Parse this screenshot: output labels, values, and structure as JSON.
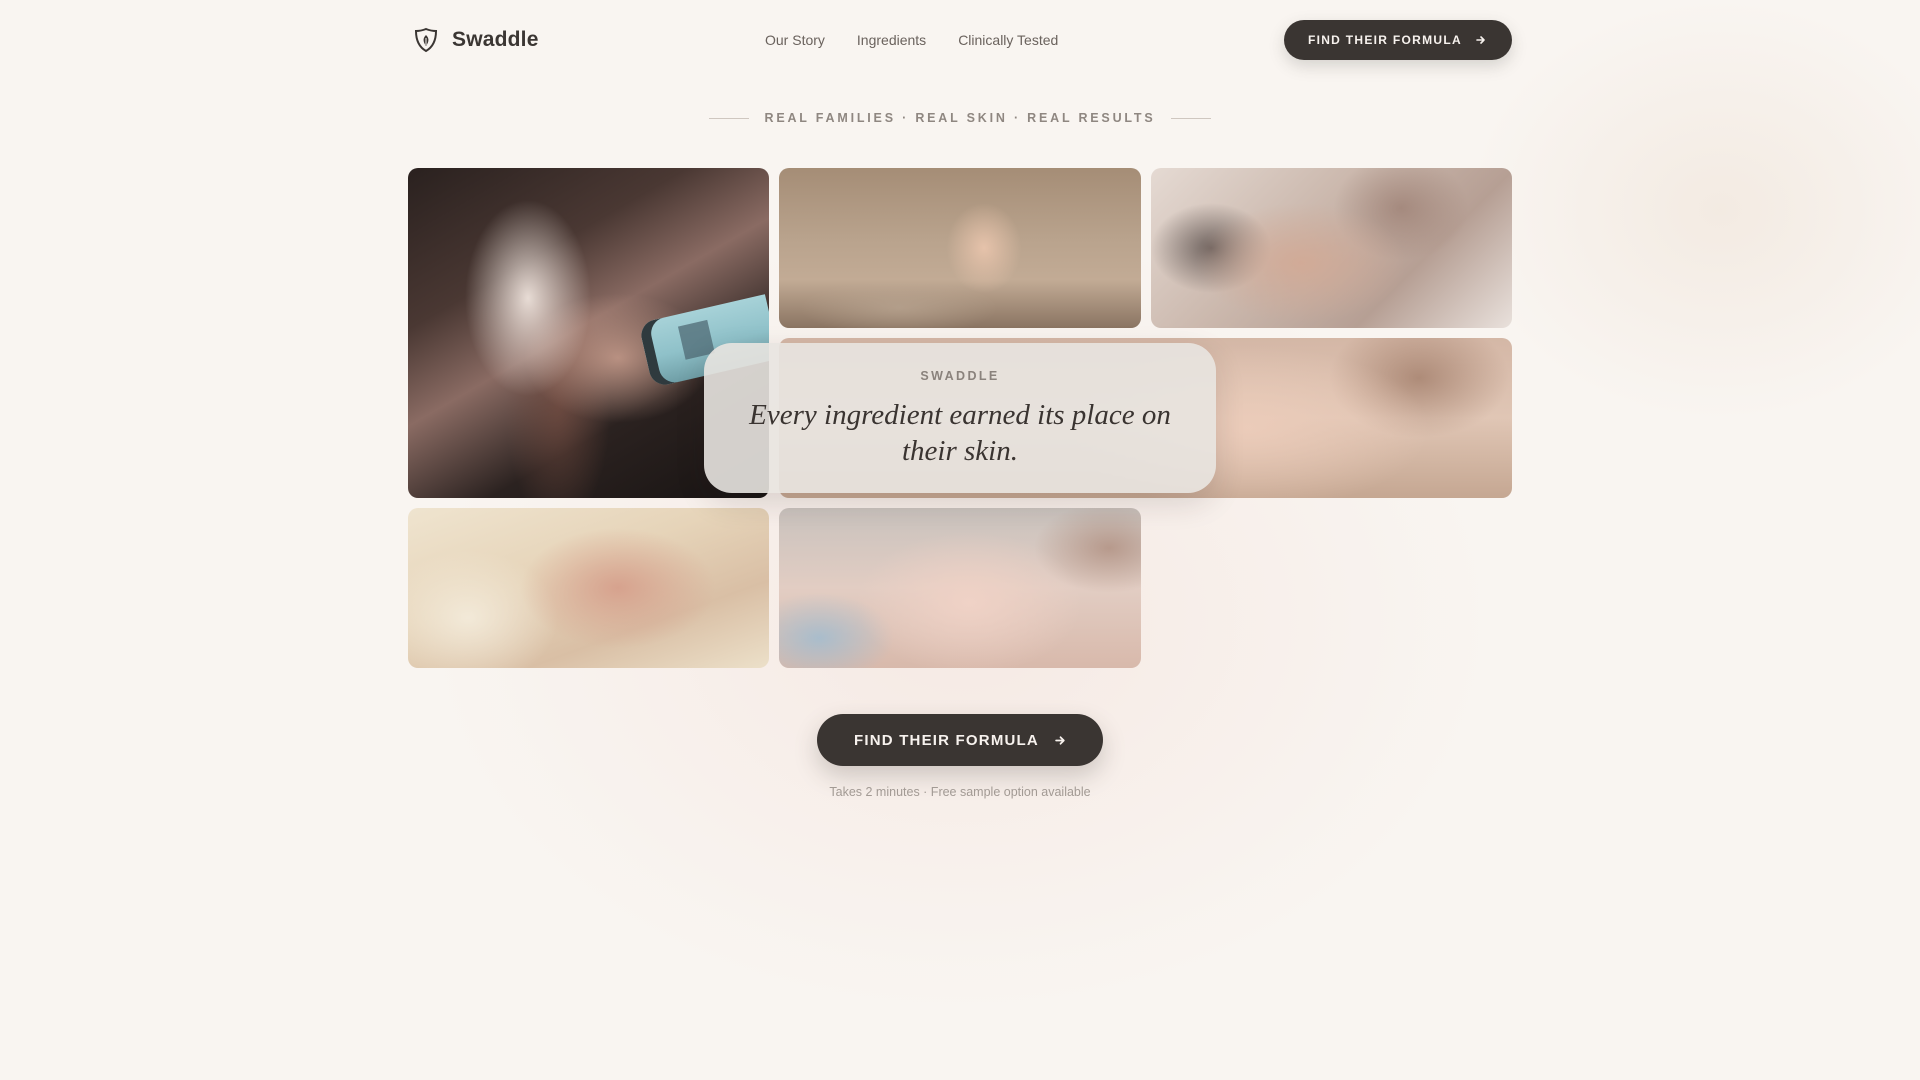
{
  "nav": {
    "brand_name": "Swaddle",
    "brand_icon": "shield-leaf-icon",
    "links": [
      "Our Story",
      "Ingredients",
      "Clinically Tested"
    ],
    "cta_label": "FIND THEIR FORMULA",
    "cta_icon": "arrow-right-icon"
  },
  "eyebrow": "REAL FAMILIES · REAL SKIN · REAL RESULTS",
  "gallery": {
    "photos": [
      "hand-applying-product-photo",
      "baby-foot-photo",
      "tattooed-hand-holding-baby-head-photo",
      "sleeping-baby-closeup-photo",
      "newborn-in-knit-blanket-photo",
      "smiling-sleeping-baby-photo"
    ]
  },
  "quote": {
    "label": "SWADDLE",
    "text": "Every ingredient earned its place on their skin."
  },
  "cta": {
    "label": "FIND THEIR FORMULA",
    "note": "Takes 2 minutes · Free sample option available"
  },
  "colors": {
    "background": "#f9f5f1",
    "button": "#3a3532",
    "button_text": "#f7f2ee",
    "muted_text": "#8f8781"
  }
}
